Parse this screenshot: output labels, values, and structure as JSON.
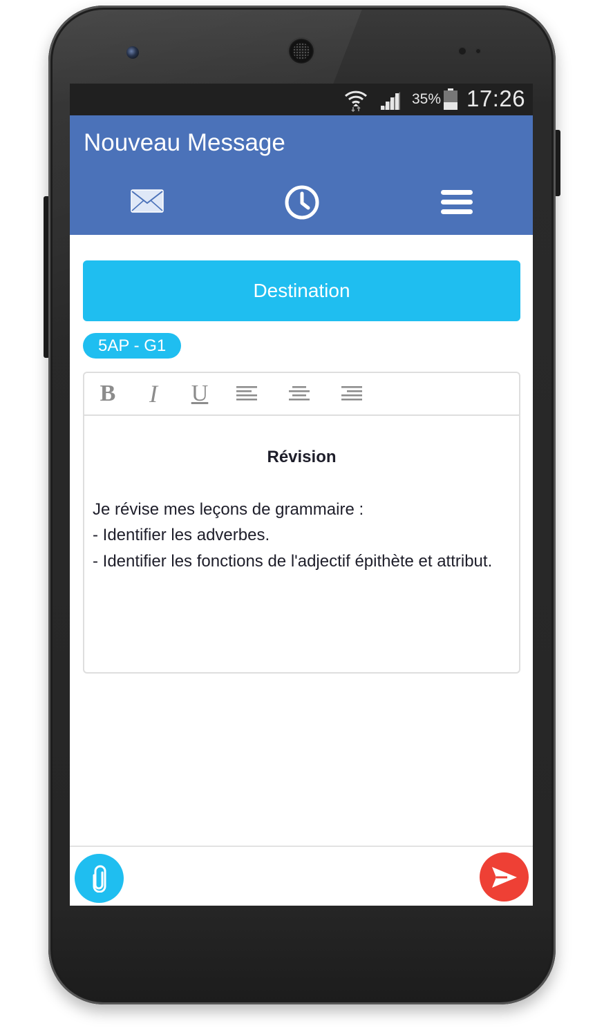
{
  "status_bar": {
    "battery_percent": "35%",
    "time": "17:26",
    "icons": [
      "wifi-icon",
      "signal-icon",
      "battery-icon"
    ]
  },
  "app_bar": {
    "title": "Nouveau Message",
    "color": "#4b72b9",
    "actions": [
      "mail-icon",
      "clock-icon",
      "menu-icon"
    ]
  },
  "destination_button": {
    "label": "Destination",
    "color": "#1fbef0"
  },
  "recipients": [
    {
      "label": "5AP - G1"
    }
  ],
  "editor": {
    "toolbar": {
      "bold": "B",
      "italic": "I",
      "underline": "U",
      "align_icons": [
        "align-left-icon",
        "align-center-icon",
        "align-right-icon"
      ]
    },
    "title": "Révision",
    "lines": [
      "Je révise mes leçons de grammaire :",
      "- Identifier les adverbes.",
      "- Identifier les fonctions de l'adjectif épithète et attribut."
    ]
  },
  "bottom_bar": {
    "attach_icon": "paperclip-icon",
    "send_icon": "send-icon",
    "send_color": "#ee4035"
  }
}
